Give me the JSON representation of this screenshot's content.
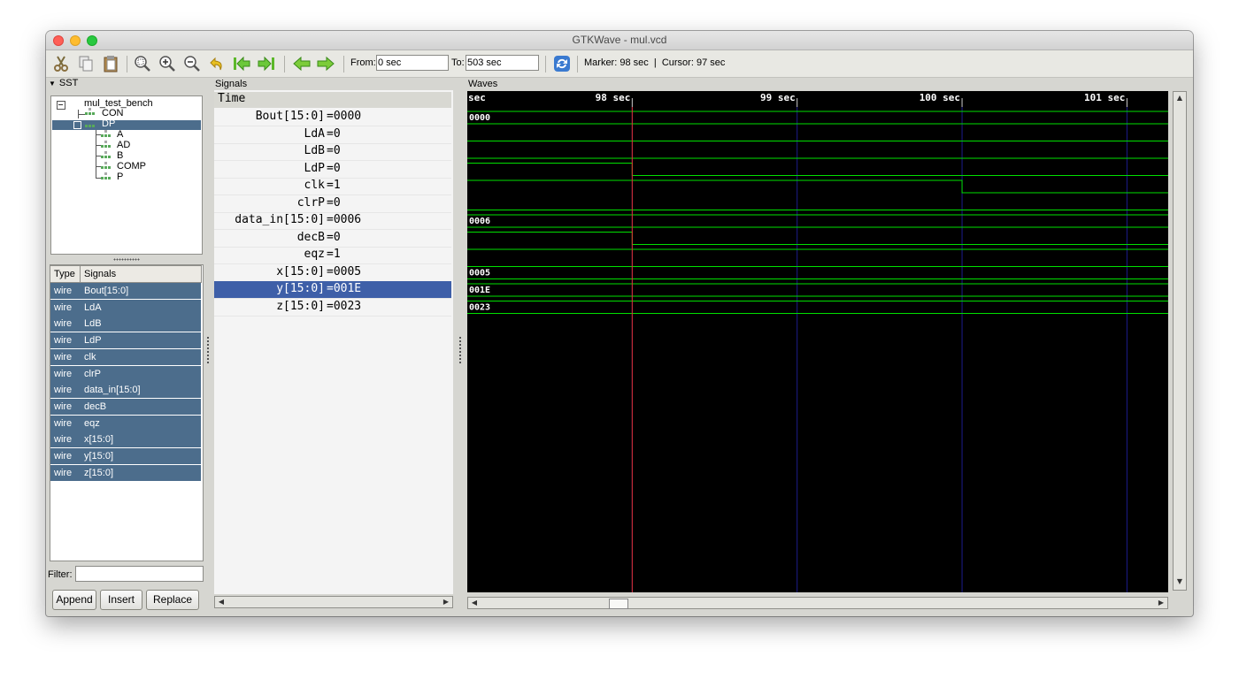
{
  "window": {
    "title": "GTKWave - mul.vcd"
  },
  "toolbar": {
    "icons": [
      "cut-icon",
      "copy-icon",
      "paste-icon",
      "zoom-fit-icon",
      "zoom-in-icon",
      "zoom-out-icon",
      "undo-icon",
      "first-icon",
      "last-icon",
      "prev-icon",
      "next-icon",
      "reload-icon"
    ],
    "from_label": "From:",
    "from_value": "0 sec",
    "to_label": "To:",
    "to_value": "503 sec",
    "marker_text": "Marker: 98 sec  |  Cursor: 97 sec"
  },
  "sst": {
    "label": "SST",
    "tree": [
      {
        "label": "mul_test_bench",
        "level": 0
      },
      {
        "label": "CON",
        "level": 1
      },
      {
        "label": "DP",
        "level": 1,
        "selected": true
      },
      {
        "label": "A",
        "level": 2
      },
      {
        "label": "AD",
        "level": 2
      },
      {
        "label": "B",
        "level": 2
      },
      {
        "label": "COMP",
        "level": 2
      },
      {
        "label": "P",
        "level": 2
      }
    ],
    "list_headers": {
      "type": "Type",
      "signals": "Signals"
    },
    "signals": [
      {
        "type": "wire",
        "name": "Bout[15:0]"
      },
      {
        "type": "wire",
        "name": "LdA"
      },
      {
        "type": "wire",
        "name": "LdB"
      },
      {
        "type": "wire",
        "name": "LdP"
      },
      {
        "type": "wire",
        "name": "clk"
      },
      {
        "type": "wire",
        "name": "clrP"
      },
      {
        "type": "wire",
        "name": "data_in[15:0]"
      },
      {
        "type": "wire",
        "name": "decB"
      },
      {
        "type": "wire",
        "name": "eqz"
      },
      {
        "type": "wire",
        "name": "x[15:0]"
      },
      {
        "type": "wire",
        "name": "y[15:0]"
      },
      {
        "type": "wire",
        "name": "z[15:0]"
      }
    ],
    "filter_label": "Filter:",
    "filter_value": "",
    "buttons": {
      "append": "Append",
      "insert": "Insert",
      "replace": "Replace"
    }
  },
  "signals_panel": {
    "label": "Signals",
    "time_label": "Time",
    "rows": [
      {
        "name": "Bout[15:0]",
        "value": "=0000",
        "selected": false
      },
      {
        "name": "LdA",
        "value": "=0",
        "selected": false
      },
      {
        "name": "LdB",
        "value": "=0",
        "selected": false
      },
      {
        "name": "LdP",
        "value": "=0",
        "selected": false
      },
      {
        "name": "clk",
        "value": "=1",
        "selected": false
      },
      {
        "name": "clrP",
        "value": "=0",
        "selected": false
      },
      {
        "name": "data_in[15:0]",
        "value": "=0006",
        "selected": false
      },
      {
        "name": "decB",
        "value": "=0",
        "selected": false
      },
      {
        "name": "eqz",
        "value": "=1",
        "selected": false
      },
      {
        "name": "x[15:0]",
        "value": "=0005",
        "selected": false
      },
      {
        "name": "y[15:0]",
        "value": "=001E",
        "selected": true
      },
      {
        "name": "z[15:0]",
        "value": "=0023",
        "selected": false
      }
    ]
  },
  "waves": {
    "label": "Waves",
    "start_tick_label": "sec",
    "tick_labels": [
      {
        "label": "98 sec",
        "t": 98
      },
      {
        "label": "99 sec",
        "t": 99
      },
      {
        "label": "100 sec",
        "t": 100
      },
      {
        "label": "101 sec",
        "t": 101
      }
    ],
    "view_start": 97,
    "view_end": 101.25,
    "marker_time": 98,
    "traces": [
      {
        "kind": "bus",
        "value": "0000"
      },
      {
        "kind": "bit",
        "segments": [
          [
            97,
            0
          ]
        ]
      },
      {
        "kind": "bit",
        "segments": [
          [
            97,
            0
          ]
        ]
      },
      {
        "kind": "bit",
        "segments": [
          [
            97,
            1
          ],
          [
            98,
            0
          ]
        ]
      },
      {
        "kind": "bit",
        "segments": [
          [
            97,
            1
          ],
          [
            100,
            0
          ]
        ]
      },
      {
        "kind": "bit",
        "segments": [
          [
            97,
            0
          ]
        ]
      },
      {
        "kind": "bus",
        "value": "0006"
      },
      {
        "kind": "bit",
        "segments": [
          [
            97,
            1
          ],
          [
            98,
            0
          ]
        ]
      },
      {
        "kind": "bit",
        "segments": [
          [
            97,
            1
          ]
        ]
      },
      {
        "kind": "bus",
        "value": "0005"
      },
      {
        "kind": "bus",
        "value": "001E"
      },
      {
        "kind": "bus",
        "value": "0023"
      }
    ],
    "colors": {
      "trace": "#00e000",
      "grid": "#1c1c8c",
      "marker": "#e03030",
      "background": "#000000",
      "text": "#ffffff"
    }
  }
}
